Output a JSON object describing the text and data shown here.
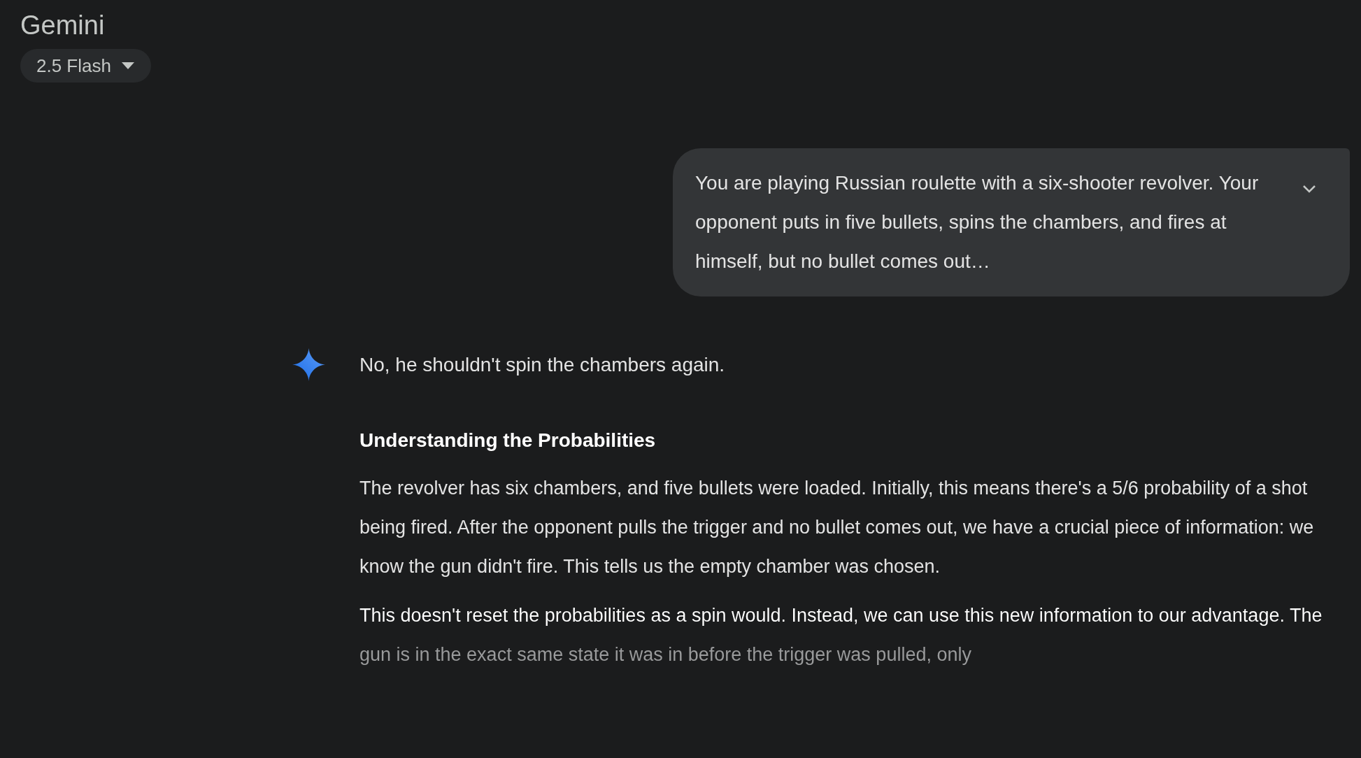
{
  "app": {
    "title": "Gemini",
    "model_selector": "2.5 Flash"
  },
  "user_message": {
    "text": "You are playing Russian roulette with a six-shooter revolver. Your opponent puts in five bullets, spins the chambers, and fires at himself, but no bullet comes out…",
    "expanded": false
  },
  "response": {
    "intro": "No, he shouldn't spin the chambers again.",
    "heading": "Understanding the Probabilities",
    "paragraphs": [
      "The revolver has six chambers, and five bullets were loaded. Initially, this means there's a 5/6 probability of a shot being fired. After the opponent pulls the trigger and no bullet comes out, we have a crucial piece of information: we know the gun didn't fire. This tells us the empty chamber was chosen.",
      "This doesn't reset the probabilities as a spin would. Instead, we can use this new information to our advantage. The gun is in the exact same state it was in before the trigger was pulled, only"
    ]
  }
}
